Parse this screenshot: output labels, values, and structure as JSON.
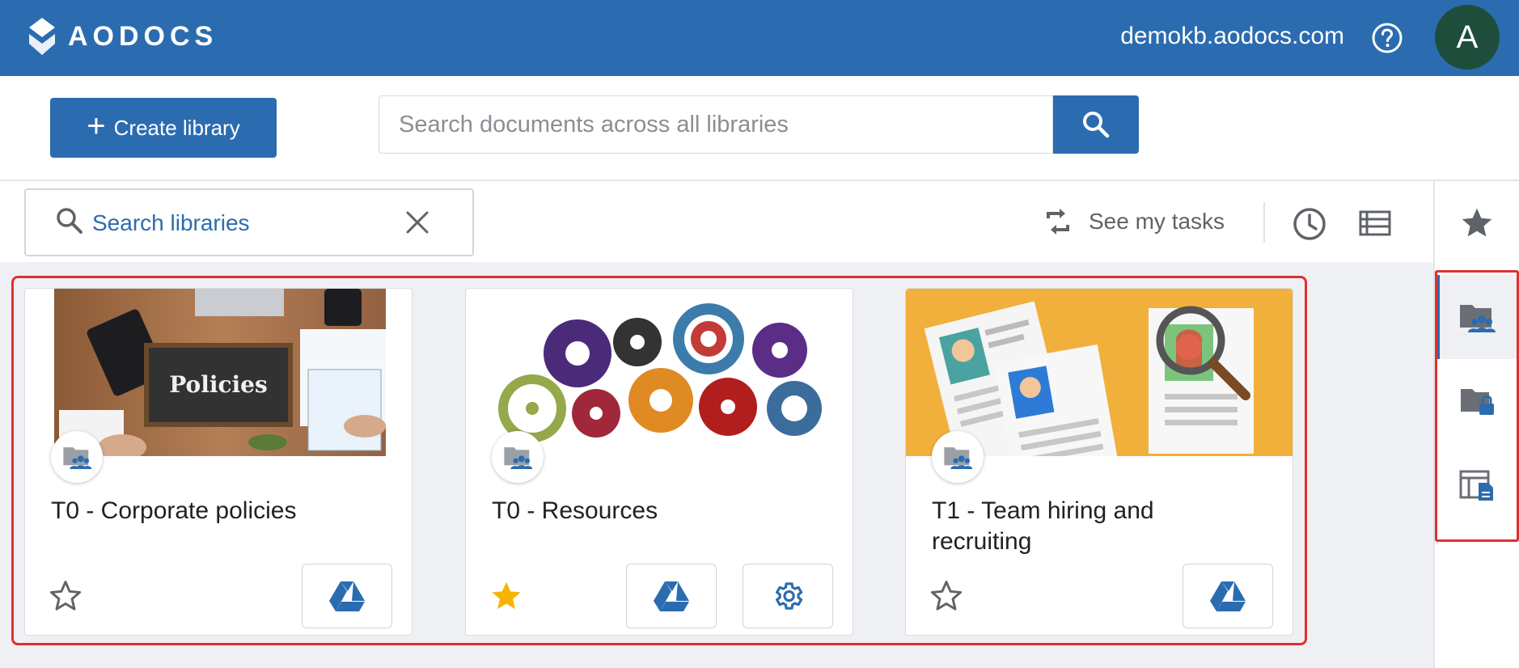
{
  "header": {
    "brand": "AODOCS",
    "domain": "demokb.aodocs.com",
    "avatar_initial": "A",
    "color": "#2b6cb0"
  },
  "toolbar": {
    "create_label": "Create library",
    "doc_search_placeholder": "Search documents across all libraries"
  },
  "filters": {
    "library_search_placeholder": "Search libraries",
    "tasks_label": "See my tasks"
  },
  "rail": {
    "items": [
      "star-icon",
      "shared-libraries-icon",
      "secured-libraries-icon",
      "template-libraries-icon"
    ],
    "active": "shared-libraries-icon"
  },
  "libraries": [
    {
      "title": "T0 - Corporate policies",
      "image_text": "Policies",
      "starred": false,
      "buttons": [
        "drive-icon"
      ]
    },
    {
      "title": "T0 - Resources",
      "starred": true,
      "buttons": [
        "drive-icon",
        "settings-gear-icon"
      ]
    },
    {
      "title": "T1 - Team hiring and recruiting",
      "starred": false,
      "buttons": [
        "drive-icon"
      ]
    }
  ],
  "colors": {
    "highlight": "#e03030",
    "star_active": "#f4b400",
    "accent": "#2b6cb0"
  }
}
